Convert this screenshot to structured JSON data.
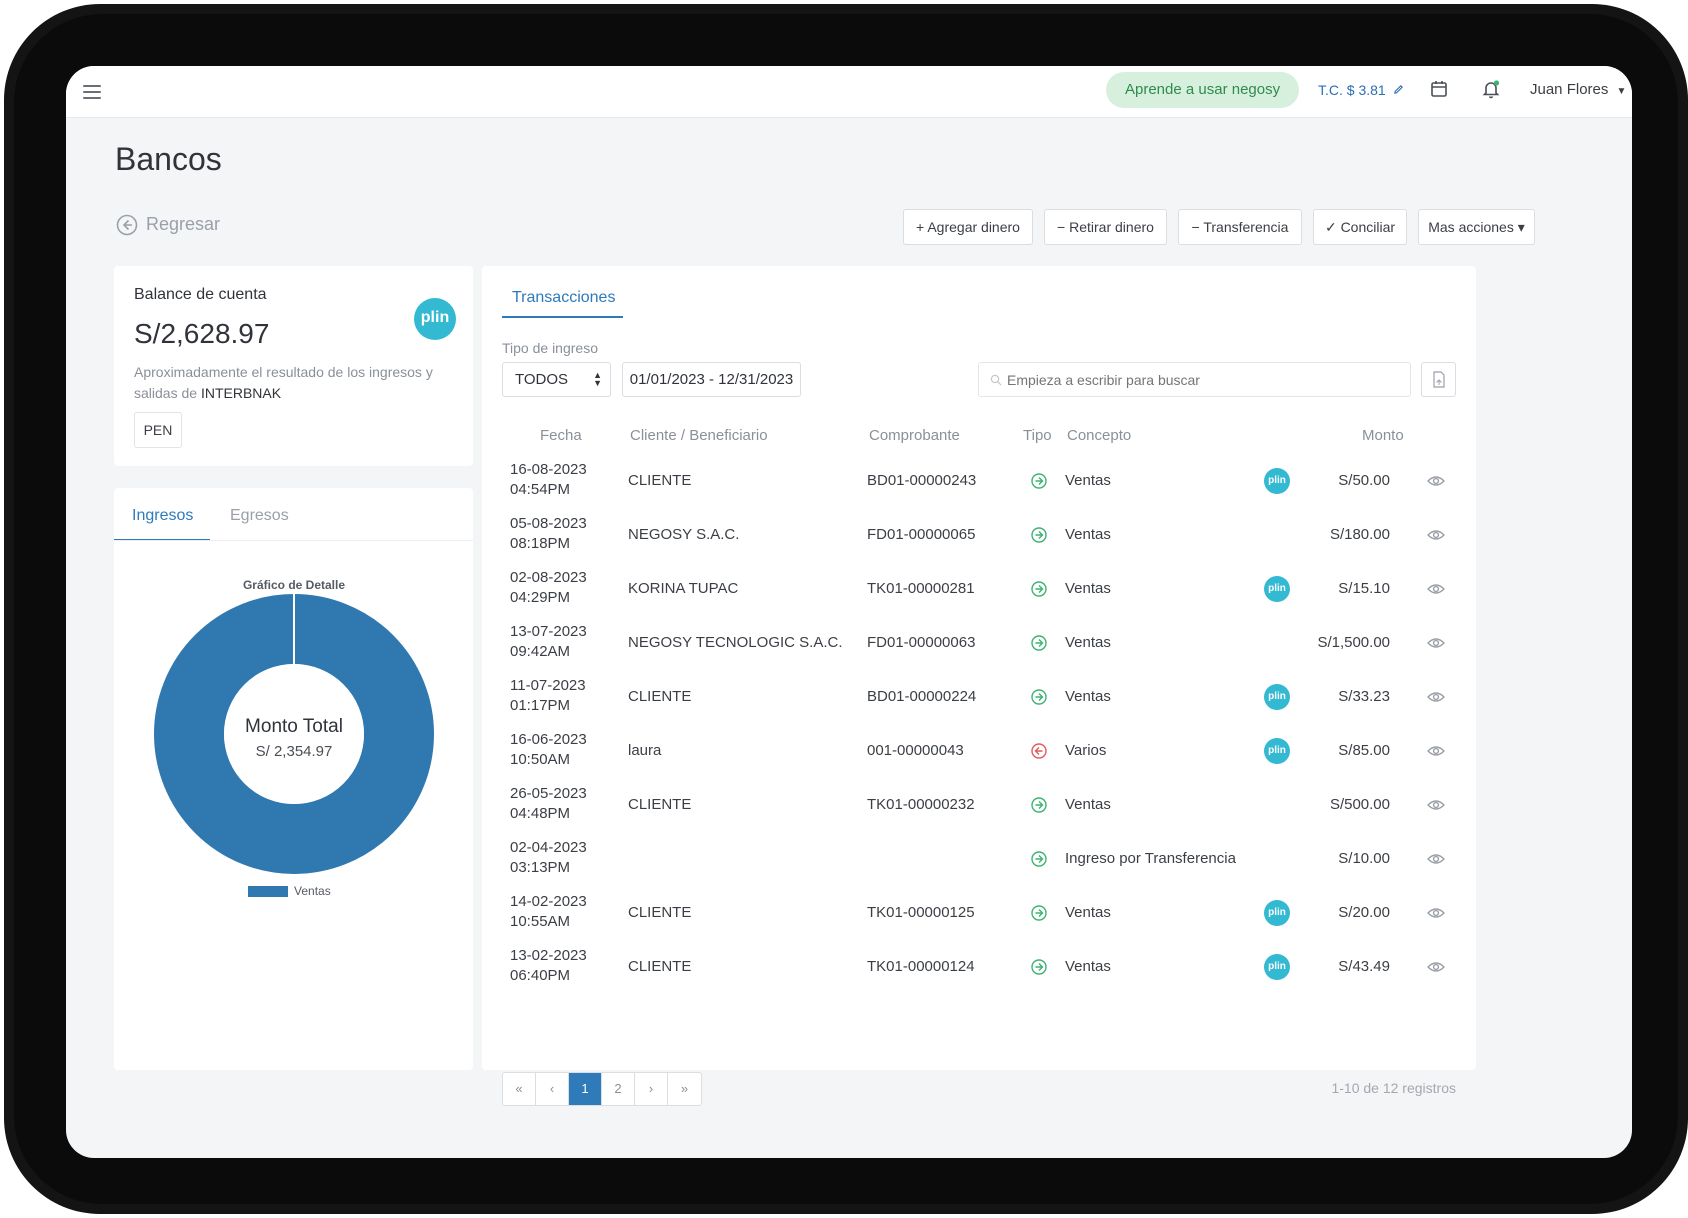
{
  "topbar": {
    "learn_label": "Aprende a usar negosy",
    "exchange_rate": "T.C. $ 3.81",
    "user_name": "Juan Flores"
  },
  "page": {
    "title": "Bancos",
    "back_label": "Regresar"
  },
  "actions": {
    "add_money": "+ Agregar dinero",
    "withdraw_money": "− Retirar dinero",
    "transfer": "− Transferencia",
    "reconcile": "✓ Conciliar",
    "more_actions": "Mas acciones ▾"
  },
  "balance": {
    "label": "Balance de cuenta",
    "value": "S/2,628.97",
    "description": "Aproximadamente el resultado de los ingresos y salidas de",
    "bank": "INTERBNAK",
    "currency": "PEN",
    "badge": "plin"
  },
  "detail_tabs": {
    "income": "Ingresos",
    "expenses": "Egresos",
    "active": "income"
  },
  "chart_data": {
    "type": "pie",
    "title": "Gráfico de Detalle",
    "center_label": "Monto Total",
    "center_value": "S/ 2,354.97",
    "categories": [
      "Ventas"
    ],
    "values": [
      2354.97
    ],
    "color": "#2f79b0",
    "legend": [
      "Ventas"
    ]
  },
  "transactions": {
    "tab_label": "Transacciones",
    "filter_label": "Tipo de ingreso",
    "filter_value": "TODOS",
    "date_range": "01/01/2023 - 12/31/2023",
    "search_placeholder": "Empieza a escribir para buscar",
    "columns": {
      "date": "Fecha",
      "client": "Cliente / Beneficiario",
      "voucher": "Comprobante",
      "type": "Tipo",
      "concept": "Concepto",
      "amount": "Monto"
    },
    "rows": [
      {
        "date": "16-08-2023",
        "time": "04:54PM",
        "client": "CLIENTE",
        "voucher": "BD01-00000243",
        "type": "in",
        "concept": "Ventas",
        "plin": true,
        "amount": "S/50.00"
      },
      {
        "date": "05-08-2023",
        "time": "08:18PM",
        "client": "NEGOSY S.A.C.",
        "voucher": "FD01-00000065",
        "type": "in",
        "concept": "Ventas",
        "plin": false,
        "amount": "S/180.00"
      },
      {
        "date": "02-08-2023",
        "time": "04:29PM",
        "client": "KORINA TUPAC",
        "voucher": "TK01-00000281",
        "type": "in",
        "concept": "Ventas",
        "plin": true,
        "amount": "S/15.10"
      },
      {
        "date": "13-07-2023",
        "time": "09:42AM",
        "client": "NEGOSY TECNOLOGIC S.A.C.",
        "voucher": "FD01-00000063",
        "type": "in",
        "concept": "Ventas",
        "plin": false,
        "amount": "S/1,500.00"
      },
      {
        "date": "11-07-2023",
        "time": "01:17PM",
        "client": "CLIENTE",
        "voucher": "BD01-00000224",
        "type": "in",
        "concept": "Ventas",
        "plin": true,
        "amount": "S/33.23"
      },
      {
        "date": "16-06-2023",
        "time": "10:50AM",
        "client": "laura",
        "voucher": "001-00000043",
        "type": "out",
        "concept": "Varios",
        "plin": true,
        "amount": "S/85.00"
      },
      {
        "date": "26-05-2023",
        "time": "04:48PM",
        "client": "CLIENTE",
        "voucher": "TK01-00000232",
        "type": "in",
        "concept": "Ventas",
        "plin": false,
        "amount": "S/500.00"
      },
      {
        "date": "02-04-2023",
        "time": "03:13PM",
        "client": "",
        "voucher": "",
        "type": "in",
        "concept": "Ingreso por Transferencia",
        "plin": false,
        "amount": "S/10.00"
      },
      {
        "date": "14-02-2023",
        "time": "10:55AM",
        "client": "CLIENTE",
        "voucher": "TK01-00000125",
        "type": "in",
        "concept": "Ventas",
        "plin": true,
        "amount": "S/20.00"
      },
      {
        "date": "13-02-2023",
        "time": "06:40PM",
        "client": "CLIENTE",
        "voucher": "TK01-00000124",
        "type": "in",
        "concept": "Ventas",
        "plin": true,
        "amount": "S/43.49"
      }
    ],
    "plin_label": "plin",
    "colors": {
      "in": "#3cb371",
      "out": "#e05a5a"
    }
  },
  "pagination": {
    "first": "«",
    "prev": "‹",
    "pages": [
      "1",
      "2"
    ],
    "active_page": "1",
    "next": "›",
    "last": "»",
    "summary": "1-10 de 12 registros"
  }
}
